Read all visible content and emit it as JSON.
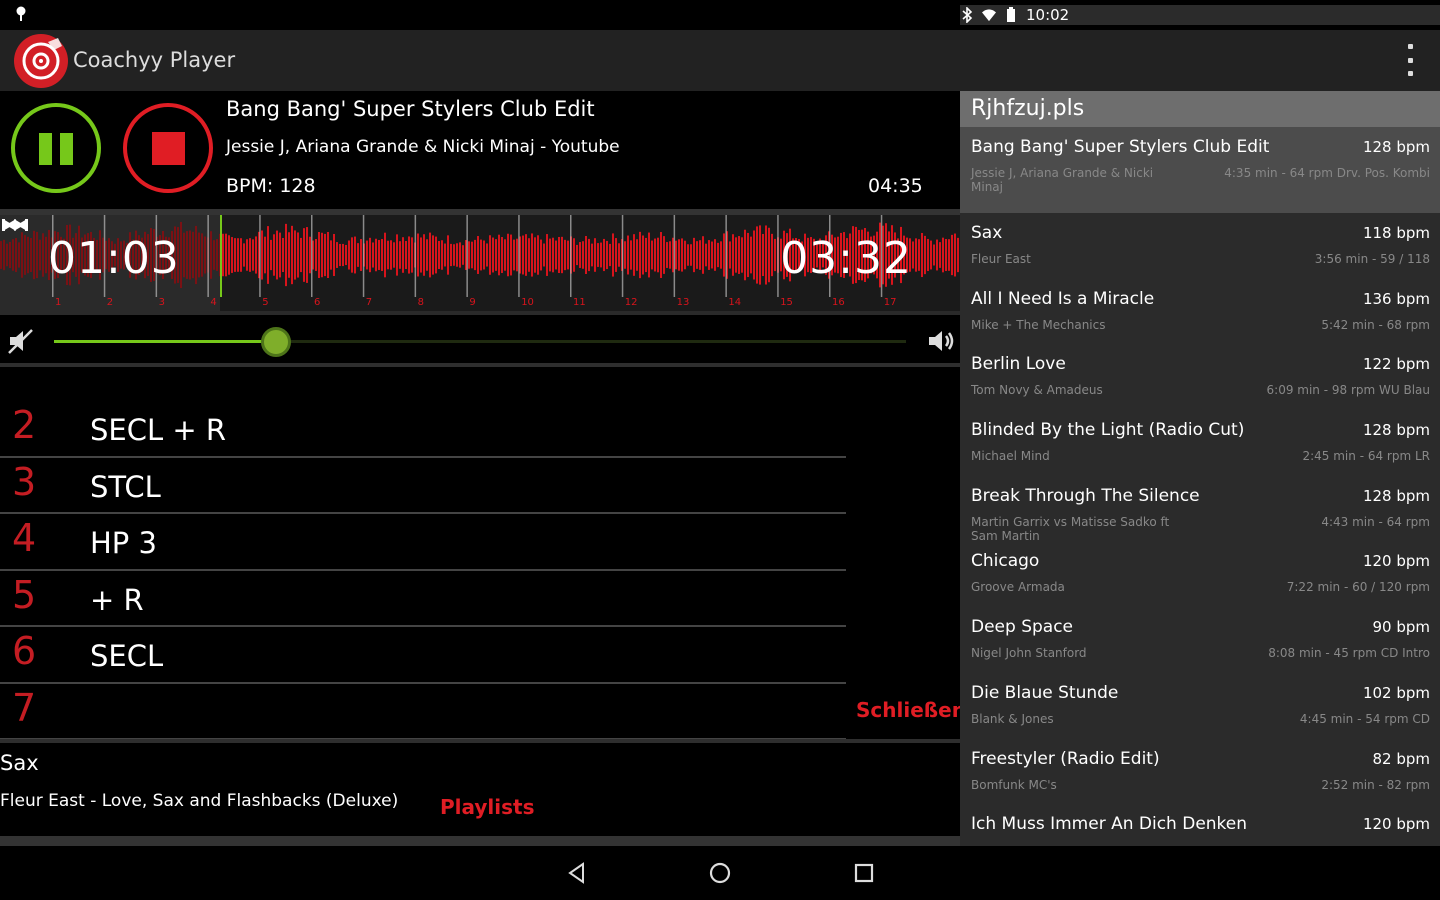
{
  "status_bar": {
    "time": "10:02",
    "icons": [
      "notification-icon",
      "bluetooth-icon",
      "wifi-icon",
      "battery-icon"
    ]
  },
  "app": {
    "title": "Coachyy Player",
    "logo": "vinyl-record-icon",
    "accent": "#e01d24",
    "green": "#76c81a"
  },
  "now_playing": {
    "title": "Bang Bang' Super Stylers Club Edit",
    "artist_line": "Jessie J, Ariana Grande & Nicki Minaj - Youtube",
    "bpm_label": "BPM: 128",
    "duration": "04:35",
    "elapsed": "01:03",
    "remaining": "03:32",
    "progress": 0.229,
    "beat_markers": [
      "1",
      "2",
      "3",
      "4",
      "5",
      "6",
      "7",
      "8",
      "9",
      "10",
      "11",
      "12",
      "13",
      "14",
      "15",
      "16",
      "17"
    ]
  },
  "volume": {
    "level": 0.26
  },
  "cues": [
    {
      "num": "2",
      "label": "SECL + R"
    },
    {
      "num": "3",
      "label": "STCL"
    },
    {
      "num": "4",
      "label": "HP 3"
    },
    {
      "num": "5",
      "label": "+ R"
    },
    {
      "num": "6",
      "label": "SECL"
    },
    {
      "num": "7",
      "label": ""
    }
  ],
  "close_label": "Schließen",
  "next_track": {
    "title": "Sax",
    "meta": "Fleur East - Love, Sax and Flashbacks (Deluxe)"
  },
  "playlists_label": "Playlists",
  "playlist": {
    "name": "Rjhfzuj.pls",
    "tracks": [
      {
        "title": "Bang Bang' Super Stylers Club Edit",
        "bpm": "128 bpm",
        "artist": "Jessie J, Ariana Grande & Nicki Minaj",
        "meta": "4:35 min - 64 rpm Drv. Pos. Kombi"
      },
      {
        "title": "Sax",
        "bpm": "118 bpm",
        "artist": "Fleur East",
        "meta": "3:56 min - 59 / 118"
      },
      {
        "title": "All I Need Is a Miracle",
        "bpm": "136 bpm",
        "artist": "Mike + The Mechanics",
        "meta": "5:42 min - 68 rpm"
      },
      {
        "title": "Berlin Love",
        "bpm": "122 bpm",
        "artist": "Tom Novy & Amadeus",
        "meta": "6:09 min - 98 rpm WU Blau"
      },
      {
        "title": "Blinded By the Light (Radio Cut)",
        "bpm": "128 bpm",
        "artist": "Michael Mind",
        "meta": "2:45 min - 64 rpm LR"
      },
      {
        "title": "Break Through The Silence",
        "bpm": "128 bpm",
        "artist": "Martin Garrix vs Matisse Sadko ft Sam Martin",
        "meta": "4:43 min - 64 rpm"
      },
      {
        "title": "Chicago",
        "bpm": "120 bpm",
        "artist": "Groove Armada",
        "meta": "7:22 min - 60 / 120 rpm"
      },
      {
        "title": "Deep Space",
        "bpm": "90 bpm",
        "artist": "Nigel John Stanford",
        "meta": "8:08 min - 45 rpm CD Intro"
      },
      {
        "title": "Die Blaue Stunde",
        "bpm": "102 bpm",
        "artist": "Blank & Jones",
        "meta": "4:45 min - 54 rpm CD"
      },
      {
        "title": "Freestyler (Radio Edit)",
        "bpm": "82 bpm",
        "artist": "Bomfunk MC's",
        "meta": "2:52 min - 82 rpm"
      },
      {
        "title": "Ich Muss Immer An Dich Denken",
        "bpm": "120 bpm",
        "artist": "",
        "meta": ""
      }
    ]
  },
  "nav": {
    "back": "back-icon",
    "home": "home-icon",
    "recents": "recents-icon"
  }
}
